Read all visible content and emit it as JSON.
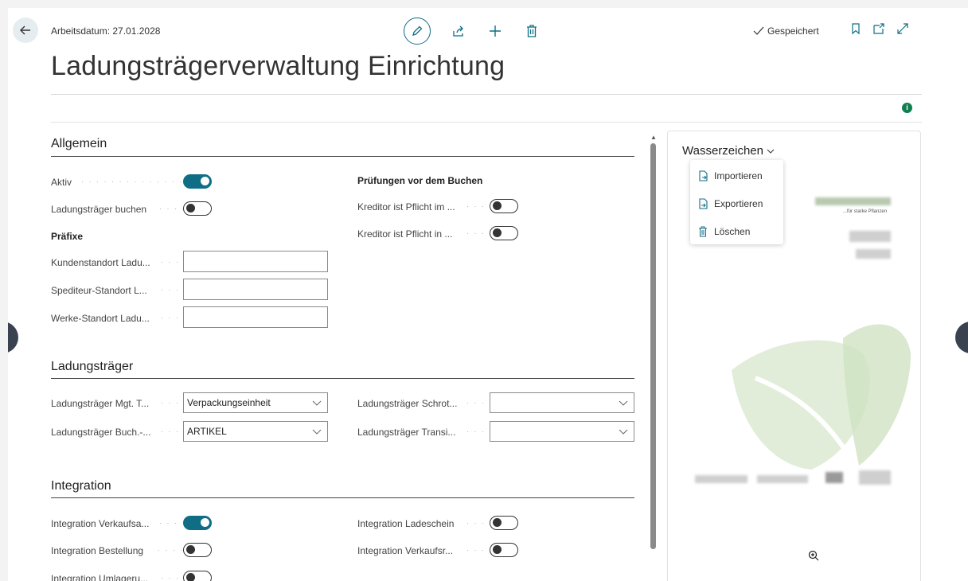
{
  "header": {
    "workdate": "Arbeitsdatum: 27.01.2028",
    "saved": "Gespeichert",
    "title": "Ladungsträgerverwaltung Einrichtung"
  },
  "allgemein": {
    "title": "Allgemein",
    "aktiv_label": "Aktiv",
    "buchen_label": "Ladungsträger buchen",
    "praefixe_head": "Präfixe",
    "kunden_label": "Kundenstandort Ladu...",
    "spediteur_label": "Spediteur-Standort L...",
    "werke_label": "Werke-Standort Ladu...",
    "pruef_head": "Prüfungen vor dem Buchen",
    "kreditor1_label": "Kreditor ist Pflicht im ...",
    "kreditor2_label": "Kreditor ist Pflicht in ...",
    "toggles": {
      "aktiv": true,
      "buchen": false,
      "kreditor1": false,
      "kreditor2": false
    }
  },
  "ladungstraeger": {
    "title": "Ladungsträger",
    "mgt_label": "Ladungsträger Mgt. T...",
    "mgt_value": "Verpackungseinheit",
    "buch_label": "Ladungsträger Buch.-...",
    "buch_value": "ARTIKEL",
    "schrot_label": "Ladungsträger Schrot...",
    "schrot_value": "",
    "transi_label": "Ladungsträger Transi...",
    "transi_value": ""
  },
  "integration": {
    "title": "Integration",
    "verkaufsa_label": "Integration Verkaufsa...",
    "bestellung_label": "Integration Bestellung",
    "umlager_label": "Integration Umlageru...",
    "ladeschein_label": "Integration Ladeschein",
    "verkaufsr_label": "Integration Verkaufsr...",
    "toggles": {
      "verkaufsa": true,
      "bestellung": false,
      "umlager": false,
      "ladeschein": false,
      "verkaufsr": false
    }
  },
  "factbox": {
    "title": "Wasserzeichen",
    "menu": [
      "Importieren",
      "Exportieren",
      "Löschen"
    ],
    "preview_caption": "...für starke Pflanzen"
  },
  "colors": {
    "accent": "#0f6e85",
    "info": "#108050"
  }
}
